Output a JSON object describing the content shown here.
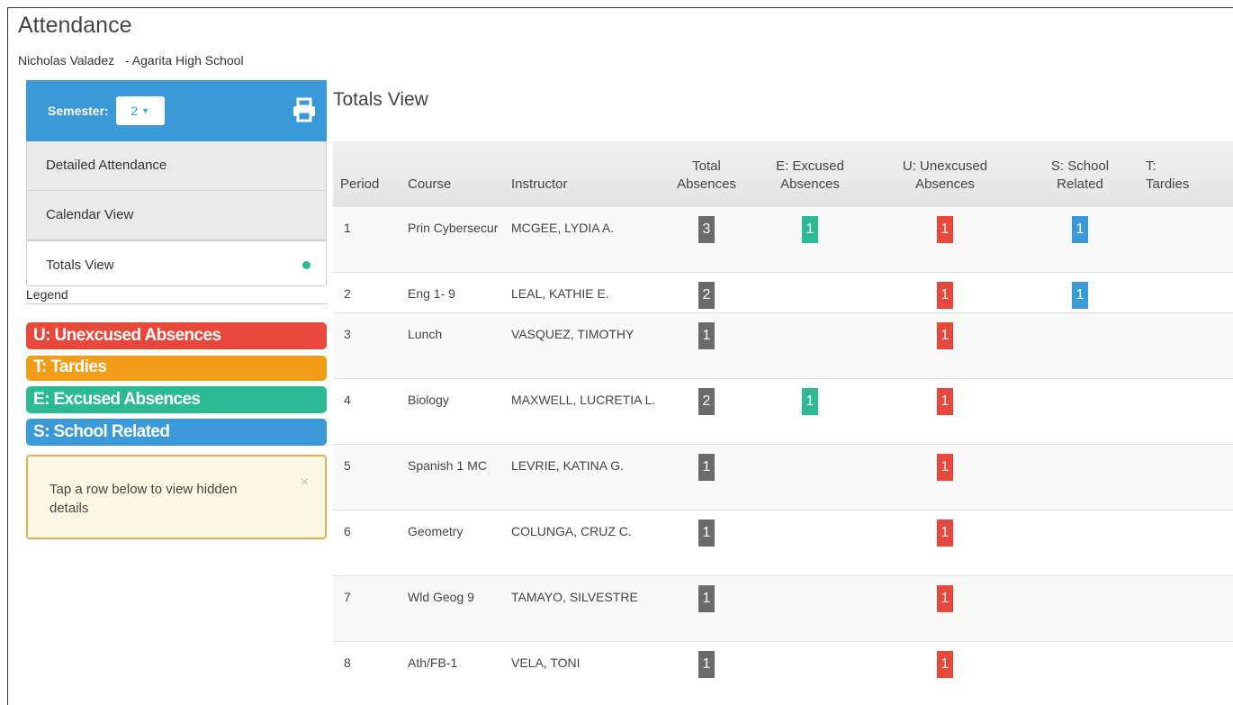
{
  "header": {
    "title": "Attendance",
    "student_name": "Nicholas Valadez",
    "school": "- Agarita High School"
  },
  "sidebar": {
    "semester_label": "Semester:",
    "semester_value": "2",
    "print_icon": "printer-icon",
    "nav": [
      {
        "label": "Detailed Attendance",
        "active": false
      },
      {
        "label": "Calendar View",
        "active": false
      },
      {
        "label": "Totals View",
        "active": true
      }
    ],
    "legend_label": "Legend",
    "legend": [
      {
        "label": "U: Unexcused Absences",
        "color": "#e8483c"
      },
      {
        "label": "T: Tardies",
        "color": "#f39c17"
      },
      {
        "label": "E: Excused Absences",
        "color": "#2bba94"
      },
      {
        "label": "S: School Related",
        "color": "#3a9ad9"
      }
    ],
    "alert_text": "Tap a row below to view hidden details",
    "alert_close": "×"
  },
  "main": {
    "title": "Totals View",
    "columns": {
      "period": "Period",
      "course": "Course",
      "instructor": "Instructor",
      "total_line1": "Total",
      "total_line2": "Absences",
      "excused_line1": "E: Excused",
      "excused_line2": "Absences",
      "unexcused_line1": "U: Unexcused",
      "unexcused_line2": "Absences",
      "school_line1": "S: School",
      "school_line2": "Related",
      "tardies_line1": "T:",
      "tardies_line2": "Tardies"
    },
    "rows": [
      {
        "period": "1",
        "course": "Prin Cybersecur",
        "instructor": "MCGEE, LYDIA A.",
        "total": "3",
        "excused": "1",
        "unexcused": "1",
        "school": "1"
      },
      {
        "period": "2",
        "course": "Eng 1- 9",
        "instructor": "LEAL, KATHIE E.",
        "total": "2",
        "excused": "",
        "unexcused": "1",
        "school": "1"
      },
      {
        "period": "3",
        "course": "Lunch",
        "instructor": "VASQUEZ, TIMOTHY",
        "total": "1",
        "excused": "",
        "unexcused": "1",
        "school": ""
      },
      {
        "period": "4",
        "course": "Biology",
        "instructor": "MAXWELL, LUCRETIA L.",
        "total": "2",
        "excused": "1",
        "unexcused": "1",
        "school": ""
      },
      {
        "period": "5",
        "course": "Spanish 1 MC",
        "instructor": "LEVRIE, KATINA G.",
        "total": "1",
        "excused": "",
        "unexcused": "1",
        "school": ""
      },
      {
        "period": "6",
        "course": "Geometry",
        "instructor": "COLUNGA, CRUZ C.",
        "total": "1",
        "excused": "",
        "unexcused": "1",
        "school": ""
      },
      {
        "period": "7",
        "course": "Wld Geog 9",
        "instructor": "TAMAYO, SILVESTRE",
        "total": "1",
        "excused": "",
        "unexcused": "1",
        "school": ""
      },
      {
        "period": "8",
        "course": "Ath/FB-1",
        "instructor": "VELA, TONI",
        "total": "1",
        "excused": "",
        "unexcused": "1",
        "school": ""
      }
    ]
  }
}
